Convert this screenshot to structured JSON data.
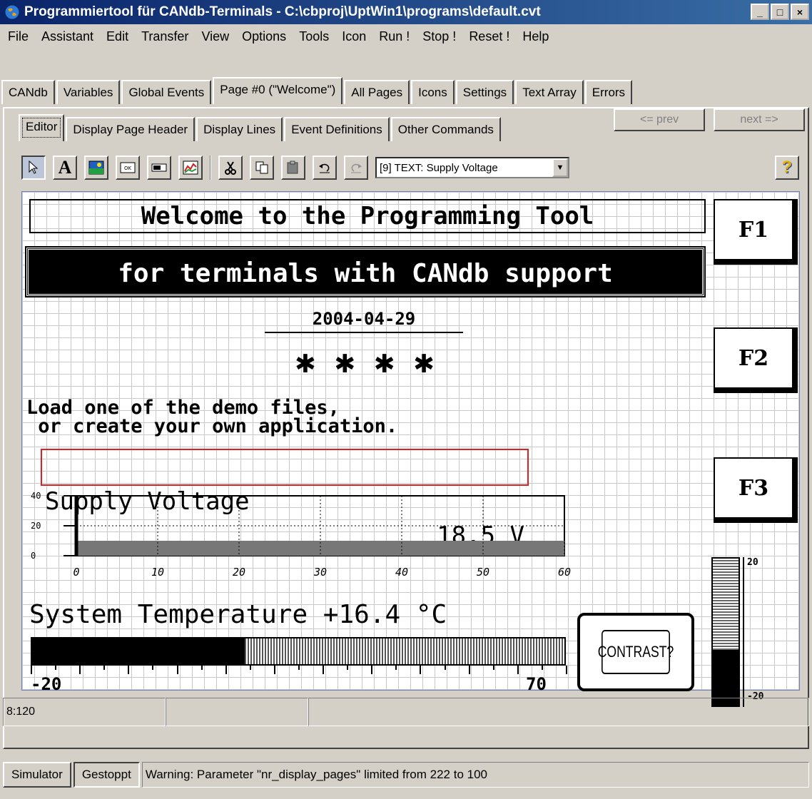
{
  "window": {
    "title": "Programmiertool für CANdb-Terminals - C:\\cbproj\\UptWin1\\programs\\default.cvt",
    "min": "_",
    "max": "□",
    "close": "×"
  },
  "menu": [
    "File",
    "Assistant",
    "Edit",
    "Transfer",
    "View",
    "Options",
    "Tools",
    "Icon",
    "Run !",
    "Stop !",
    "Reset !",
    "Help"
  ],
  "tabs": [
    "CANdb",
    "Variables",
    "Global Events",
    "Page #0 (\"Welcome\")",
    "All Pages",
    "Icons",
    "Settings",
    "Text Array",
    "Errors"
  ],
  "subtabs": [
    "Editor",
    "Display Page Header",
    "Display Lines",
    "Event Definitions",
    "Other Commands"
  ],
  "nav": {
    "prev": "<= prev",
    "next": "next =>"
  },
  "toolbar": {
    "object_select": "[9] TEXT: Supply Voltage",
    "help": "?"
  },
  "display": {
    "line1": "Welcome to the Programming Tool",
    "line2": "for terminals with CANdb support",
    "date": "2004-04-29",
    "stars": "✱ ✱ ✱ ✱",
    "load1": "Load one of the demo files,",
    "load2": " or create your own application.",
    "voltage_label": "Supply Voltage",
    "voltage_value": "18.5 V",
    "temp_label": "System Temperature +16.4 °C",
    "temp_min": "-20",
    "temp_max": "70",
    "temp_fraction": 0.4,
    "contrast": "CONTRAST?",
    "vbar_top": "20",
    "vbar_bottom": "-20",
    "vbar_fraction": 0.38
  },
  "chart_data": {
    "type": "bar",
    "x_ticks": [
      "0",
      "10",
      "20",
      "30",
      "40",
      "50",
      "60"
    ],
    "y_ticks": [
      "40",
      "20",
      "0"
    ],
    "xlim": [
      0,
      60
    ],
    "ylim": [
      0,
      40
    ],
    "values": [
      10
    ]
  },
  "fkeys": [
    "F1",
    "F2",
    "F3"
  ],
  "status": {
    "pos": "8:120",
    "cell2": "",
    "cell3": ""
  },
  "bottom": {
    "simulator": "Simulator",
    "state": "Gestoppt",
    "message": "Warning: Parameter \"nr_display_pages\" limited from 222 to 100"
  }
}
